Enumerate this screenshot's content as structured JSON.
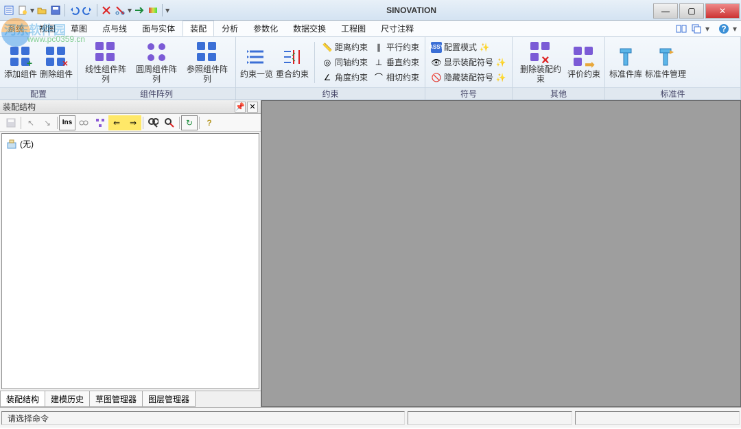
{
  "app": {
    "title": "SINOVATION"
  },
  "watermark": {
    "text1": "河东软件园",
    "text2": "www.pc0359.cn"
  },
  "menus": {
    "items": [
      "系统",
      "视图",
      "草图",
      "点与线",
      "面与实体",
      "装配",
      "分析",
      "参数化",
      "数据交换",
      "工程图",
      "尺寸注释"
    ],
    "active_index": 5
  },
  "ribbon": {
    "groups": [
      {
        "title": "配置",
        "buttons": [
          {
            "label": "添加组件",
            "icon": "add-component"
          },
          {
            "label": "删除组件",
            "icon": "remove-component"
          }
        ]
      },
      {
        "title": "组件阵列",
        "buttons": [
          {
            "label": "线性组件阵列",
            "icon": "linear-array"
          },
          {
            "label": "圆周组件阵列",
            "icon": "circular-array"
          },
          {
            "label": "参照组件阵列",
            "icon": "reference-array"
          }
        ]
      },
      {
        "title": "约束",
        "big_buttons": [
          {
            "label": "约束一览",
            "icon": "constraint-list"
          },
          {
            "label": "重合约束",
            "icon": "coincident"
          }
        ],
        "constraints_a": [
          {
            "label": "距离约束",
            "icon": "distance"
          },
          {
            "label": "同轴约束",
            "icon": "coaxial"
          },
          {
            "label": "角度约束",
            "icon": "angle"
          }
        ],
        "constraints_b": [
          {
            "label": "平行约束",
            "icon": "parallel"
          },
          {
            "label": "垂直约束",
            "icon": "perpendicular"
          },
          {
            "label": "相切约束",
            "icon": "tangent"
          }
        ]
      },
      {
        "title": "符号",
        "rows": [
          {
            "label": "配置模式",
            "icon": "config-mode",
            "trail": "magic"
          },
          {
            "label": "显示装配符号",
            "icon": "show-sym",
            "trail": "magic"
          },
          {
            "label": "隐藏装配符号",
            "icon": "hide-sym",
            "trail": "magic"
          }
        ]
      },
      {
        "title": "其他",
        "buttons": [
          {
            "label": "删除装配约束",
            "icon": "delete-constraint"
          },
          {
            "label": "评价约束",
            "icon": "evaluate-constraint"
          }
        ]
      },
      {
        "title": "标准件",
        "buttons": [
          {
            "label": "标准件库",
            "icon": "std-lib"
          },
          {
            "label": "标准件管理",
            "icon": "std-manage"
          }
        ]
      }
    ]
  },
  "panel": {
    "title": "装配结构",
    "tree_root": "(无)",
    "tabs": [
      "装配结构",
      "建模历史",
      "草图管理器",
      "图层管理器"
    ],
    "active_tab": 0,
    "toolbar_icons": [
      "save",
      "arrow-ne",
      "arrow-sw",
      "ins",
      "link",
      "tree",
      "in",
      "out",
      "find",
      "find-next",
      "refresh",
      "help"
    ]
  },
  "status": {
    "message": "请选择命令"
  },
  "qat_icons": [
    "doc-new",
    "folder-open",
    "save",
    "undo",
    "redo",
    "delete-red",
    "delete-x",
    "arrow-right",
    "gradient"
  ]
}
